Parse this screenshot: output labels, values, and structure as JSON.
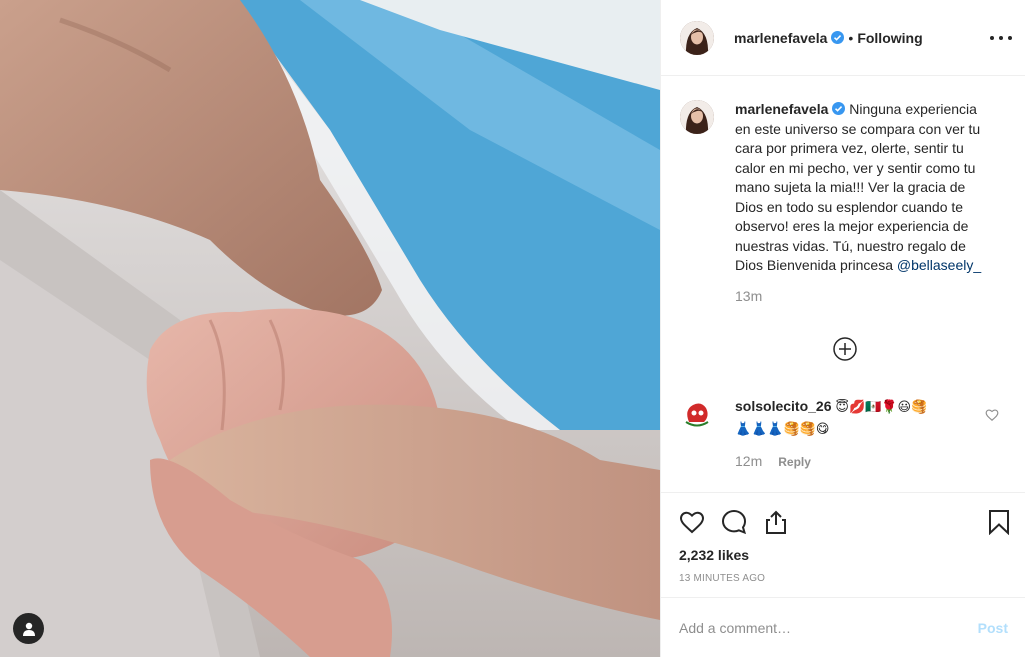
{
  "post": {
    "author": "marlenefavela",
    "verified": true,
    "follow_status": "Following",
    "dot": "•",
    "photo_alt": "photo of newborn baby hand holding a finger",
    "icons": {
      "more": "more-options-icon",
      "user_tags": "person-icon",
      "verified": "verified-badge-icon",
      "load_more": "plus-circle-icon",
      "like": "heart-icon",
      "comment": "comment-icon",
      "share": "share-icon",
      "save": "bookmark-icon"
    }
  },
  "caption": {
    "author": "marlenefavela",
    "text": "Ninguna experiencia en este universo se compara con ver tu cara por primera vez, olerte, sentir tu calor en mi pecho, ver y sentir como tu mano sujeta la mia!!! Ver la gracia de Dios en todo su esplendor cuando te observo! eres la mejor experiencia de nuestras vidas. Tú, nuestro regalo de Dios Bienvenida princesa",
    "mention": "@bellaseely_",
    "time": "13m"
  },
  "comments": [
    {
      "author": "solsolecito_26",
      "emojis": "😇💋🇲🇽🌹😃🥞\n👗👗👗🥞🥞😋",
      "time": "12m",
      "reply_label": "Reply"
    }
  ],
  "engagement": {
    "likes": "2,232 likes",
    "timestamp": "13 MINUTES AGO"
  },
  "add_comment": {
    "placeholder": "Add a comment…",
    "post_label": "Post"
  },
  "colors": {
    "text": "#262626",
    "secondary": "#8e8e8e",
    "border": "#efefef",
    "link": "#003569",
    "verified": "#3897f0",
    "post_disabled": "#b2dffc"
  }
}
